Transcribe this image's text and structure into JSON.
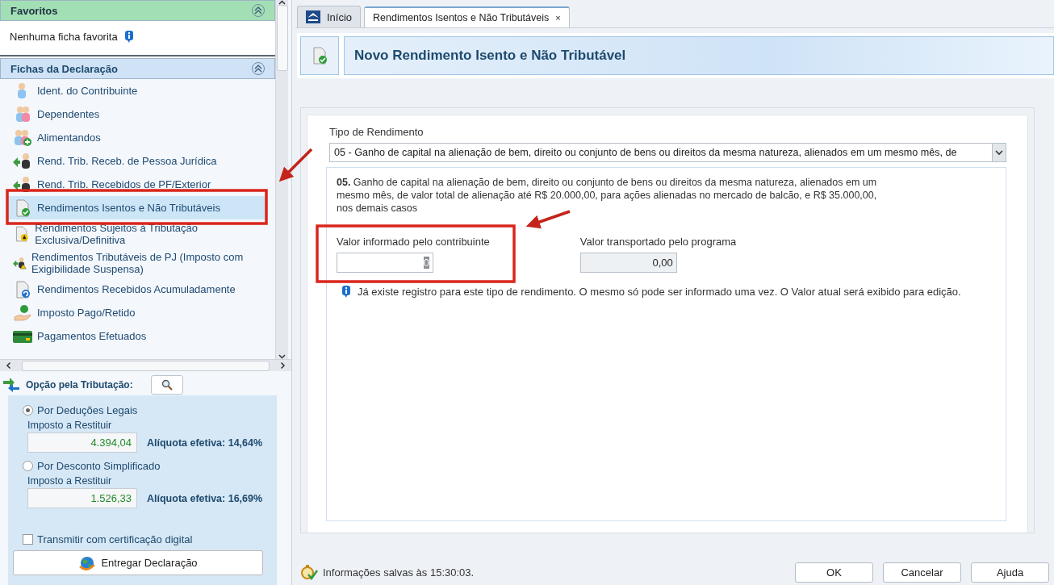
{
  "sidebar": {
    "favorites": {
      "title": "Favoritos",
      "expanded": true,
      "empty_text": "Nenhuma ficha favorita"
    },
    "fichas": {
      "title": "Fichas da Declaração",
      "expanded": true,
      "items": [
        {
          "label": "Ident. do Contribuinte",
          "kind": "person",
          "selected": false
        },
        {
          "label": "Dependentes",
          "kind": "people",
          "selected": false
        },
        {
          "label": "Alimentandos",
          "kind": "people-add",
          "selected": false
        },
        {
          "label": "Rend. Trib. Receb. de Pessoa Jurídica",
          "kind": "arrow-person",
          "selected": false
        },
        {
          "label": "Rend. Trib. Recebidos de PF/Exterior",
          "kind": "arrow-person",
          "selected": false
        },
        {
          "label": "Rendimentos Isentos e Não Tributáveis",
          "kind": "doc-check",
          "selected": true
        },
        {
          "label": "Rendimentos Sujeitos à Tributação Exclusiva/Definitiva",
          "kind": "doc-warning",
          "selected": false
        },
        {
          "label": "Rendimentos Tributáveis de PJ (Imposto com Exigibilidade Suspensa)",
          "kind": "arrow-person-warning",
          "selected": false
        },
        {
          "label": "Rendimentos Recebidos Acumuladamente",
          "kind": "doc-refresh",
          "selected": false
        },
        {
          "label": "Imposto Pago/Retido",
          "kind": "money-hand",
          "selected": false
        },
        {
          "label": "Pagamentos Efetuados",
          "kind": "card",
          "selected": false
        }
      ]
    },
    "tax_option": {
      "title": "Opção pela Tributação:",
      "options": [
        {
          "label": "Por Deduções Legais",
          "selected": true,
          "amount_label": "Imposto a Restituir",
          "amount": "4.394,04",
          "rate": "Alíquota efetiva: 14,64%"
        },
        {
          "label": "Por Desconto Simplificado",
          "selected": false,
          "amount_label": "Imposto a Restituir",
          "amount": "1.526,33",
          "rate": "Alíquota efetiva: 16,69%"
        }
      ],
      "digital_cert": {
        "label": "Transmitir com certificação digital",
        "checked": false
      },
      "submit_button": "Entregar Declaração"
    }
  },
  "tabs": [
    {
      "label": "Início",
      "selected": false,
      "closable": false
    },
    {
      "label": "Rendimentos Isentos e Não Tributáveis",
      "selected": true,
      "closable": true,
      "close": "×"
    }
  ],
  "header": {
    "title": "Novo Rendimento Isento e Não Tributável"
  },
  "form": {
    "type_label": "Tipo de Rendimento",
    "type_value": "05 - Ganho de capital na alienação de bem, direito ou conjunto de bens ou direitos da mesma natureza, alienados em um mesmo mês, de",
    "description": "**05.** Ganho de capital na alienação de bem, direito ou conjunto de bens ou direitos da mesma natureza, alienados em um mesmo mês, de valor total de alienação até R$ 20.000,00, para ações alienadas no mercado de balcão, e R$ 35.000,00, nos demais casos",
    "fields": [
      {
        "label": "Valor informado pelo contribuinte",
        "value": "0",
        "editable": true
      },
      {
        "label": "Valor transportado pelo programa",
        "value": "0,00",
        "editable": false
      }
    ],
    "notice": "Já existe registro para este tipo de rendimento. O mesmo só pode ser informado uma vez. O Valor atual será exibido para edição."
  },
  "status": {
    "text": "Informações salvas às 15:30:03."
  },
  "buttons": [
    "OK",
    "Cancelar",
    "Ajuda"
  ]
}
